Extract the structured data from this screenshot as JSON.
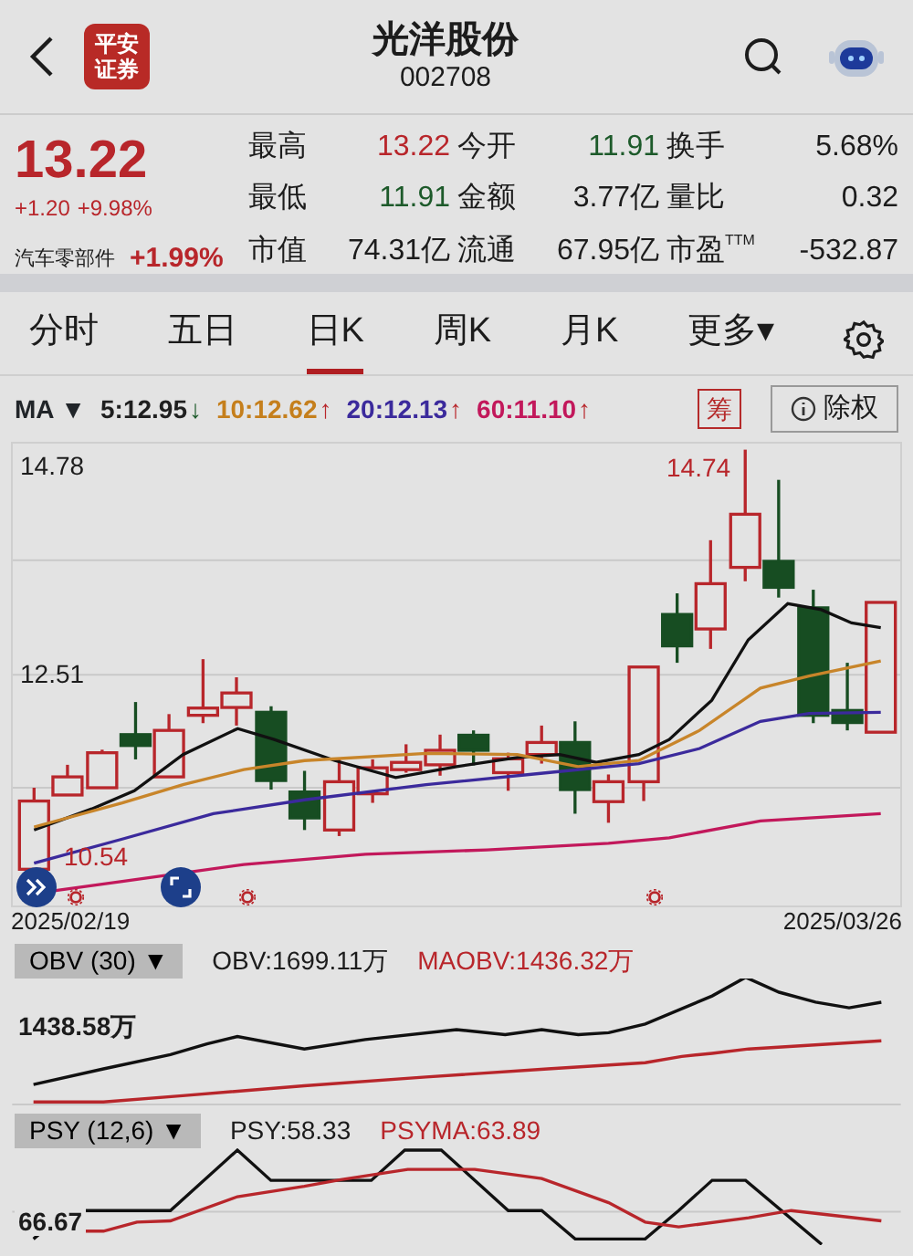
{
  "header": {
    "logo_lines": [
      "平安",
      "证券"
    ],
    "title": "光洋股份",
    "code": "002708"
  },
  "quote": {
    "price": "13.22",
    "change": "+1.20",
    "change_pct": "+9.98%",
    "sector": "汽车零部件",
    "sector_change": "+1.99%",
    "color": "#b8262b",
    "stats": [
      {
        "label": "最高",
        "value": "13.22",
        "color": "#b8262b"
      },
      {
        "label": "今开",
        "value": "11.91",
        "color": "#1d5a2a"
      },
      {
        "label": "换手",
        "value": "5.68%",
        "color": "#1c1c1c"
      },
      {
        "label": "最低",
        "value": "11.91",
        "color": "#1d5a2a"
      },
      {
        "label": "金额",
        "value": "3.77亿",
        "color": "#1c1c1c"
      },
      {
        "label": "量比",
        "value": "0.32",
        "color": "#1c1c1c"
      },
      {
        "label": "市值",
        "value": "74.31亿",
        "color": "#1c1c1c"
      },
      {
        "label": "流通",
        "value": "67.95亿",
        "color": "#1c1c1c"
      },
      {
        "label": "市盈$^{TTM}$",
        "value": "-532.87",
        "color": "#1c1c1c"
      }
    ]
  },
  "tabs": [
    {
      "label": "分时",
      "selected": false
    },
    {
      "label": "五日",
      "selected": false
    },
    {
      "label": "日K",
      "selected": true
    },
    {
      "label": "周K",
      "selected": false
    },
    {
      "label": "月K",
      "selected": false
    },
    {
      "label": "更多▾",
      "selected": false
    }
  ],
  "ma_bar": {
    "label": "MA ▼",
    "items": [
      {
        "label": "5:12.95",
        "color": "#1f1f1f",
        "arrow": {
          "text": "↓",
          "color": "#1d5a2a"
        }
      },
      {
        "label": "10:12.62",
        "color": "#c57f1c",
        "arrow": {
          "text": "↑",
          "color": "#b8262b"
        }
      },
      {
        "label": "20:12.13",
        "color": "#3b2a9c",
        "arrow": {
          "text": "↑",
          "color": "#b8262b"
        }
      },
      {
        "label": "60:11.10",
        "color": "#c2185b",
        "arrow": {
          "text": "↑",
          "color": "#b8262b"
        }
      }
    ],
    "chip_button": "筹",
    "adjust_button": "除权"
  },
  "kline": {
    "top_label": "14.78",
    "mid_label": "12.51",
    "high_label": "14.74",
    "low_label": "10.54",
    "start_date": "2025/02/19",
    "end_date": "2025/03/26"
  },
  "obv": {
    "selector": "OBV (30) ▼",
    "value": "OBV:1699.11万",
    "ma_value": "MAOBV:1436.32万",
    "axis_label": "1438.58万"
  },
  "psy": {
    "selector": "PSY (12,6) ▼",
    "value": "PSY:58.33",
    "ma_value": "PSYMA:63.89",
    "axis_label": "66.67"
  }
}
